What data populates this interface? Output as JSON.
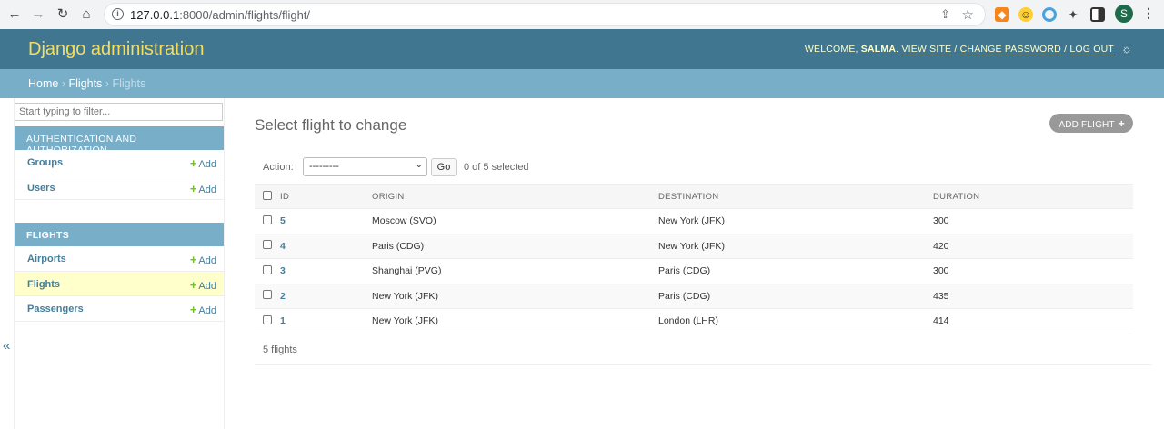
{
  "browser": {
    "url_host": "127.0.0.1",
    "url_rest": ":8000/admin/flights/flight/",
    "profile_initial": "S"
  },
  "header": {
    "branding": "Django administration",
    "welcome": "WELCOME,",
    "username": "SALMA",
    "view_site": "VIEW SITE",
    "change_password": "CHANGE PASSWORD",
    "log_out": "LOG OUT",
    "sep": "/"
  },
  "breadcrumbs": {
    "home": "Home",
    "app": "Flights",
    "current": "Flights",
    "sep": "›"
  },
  "sidebar": {
    "filter_placeholder": "Start typing to filter...",
    "modules": [
      {
        "caption": "AUTHENTICATION AND AUTHORIZATION",
        "items": [
          {
            "name": "Groups",
            "add": "Add"
          },
          {
            "name": "Users",
            "add": "Add"
          }
        ]
      },
      {
        "caption": "FLIGHTS",
        "items": [
          {
            "name": "Airports",
            "add": "Add"
          },
          {
            "name": "Flights",
            "add": "Add"
          },
          {
            "name": "Passengers",
            "add": "Add"
          }
        ]
      }
    ],
    "collapse_glyph": "«"
  },
  "main": {
    "title": "Select flight to change",
    "add_button": "ADD FLIGHT",
    "action_label": "Action:",
    "action_value": "---------",
    "go": "Go",
    "selected": "0 of 5 selected",
    "columns": [
      "ID",
      "ORIGIN",
      "DESTINATION",
      "DURATION"
    ],
    "rows": [
      {
        "id": "5",
        "origin": "Moscow (SVO)",
        "destination": "New York (JFK)",
        "duration": "300"
      },
      {
        "id": "4",
        "origin": "Paris (CDG)",
        "destination": "New York (JFK)",
        "duration": "420"
      },
      {
        "id": "3",
        "origin": "Shanghai (PVG)",
        "destination": "Paris (CDG)",
        "duration": "300"
      },
      {
        "id": "2",
        "origin": "New York (JFK)",
        "destination": "Paris (CDG)",
        "duration": "435"
      },
      {
        "id": "1",
        "origin": "New York (JFK)",
        "destination": "London (LHR)",
        "duration": "414"
      }
    ],
    "count": "5 flights"
  },
  "colors": {
    "header": "#417690",
    "breadcrumbs": "#79aec8",
    "branding": "#f5dd5d",
    "link": "#447e9b",
    "add_green": "#70bf2b",
    "current_row": "#ffffcc"
  }
}
